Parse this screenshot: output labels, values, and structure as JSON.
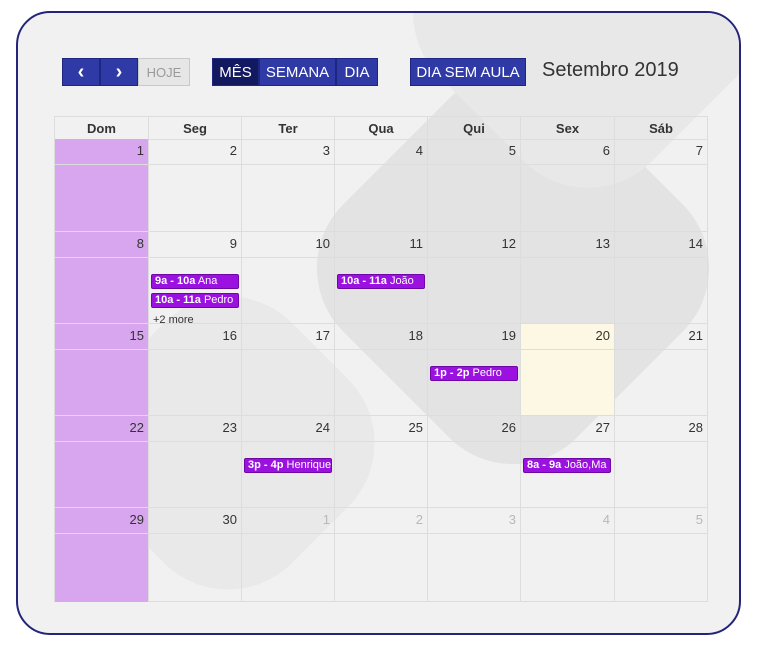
{
  "toolbar": {
    "prev_icon": "‹",
    "next_icon": "›",
    "today_label": "HOJE",
    "month_label": "MÊS",
    "week_label": "SEMANA",
    "day_label": "DIA",
    "no_class_label": "DIA SEM AULA"
  },
  "title": "Setembro 2019",
  "weekdays": [
    "Dom",
    "Seg",
    "Ter",
    "Qua",
    "Qui",
    "Sex",
    "Sáb"
  ],
  "weeks": [
    [
      "1",
      "2",
      "3",
      "4",
      "5",
      "6",
      "7"
    ],
    [
      "8",
      "9",
      "10",
      "11",
      "12",
      "13",
      "14"
    ],
    [
      "15",
      "16",
      "17",
      "18",
      "19",
      "20",
      "21"
    ],
    [
      "22",
      "23",
      "24",
      "25",
      "26",
      "27",
      "28"
    ],
    [
      "29",
      "30",
      "1",
      "2",
      "3",
      "4",
      "5"
    ]
  ],
  "events": [
    {
      "time": "9a - 10a",
      "title": "Ana"
    },
    {
      "time": "10a - 11a",
      "title": "Pedro"
    },
    {
      "time": "10a - 11a",
      "title": "João"
    },
    {
      "time": "1p - 2p",
      "title": "Pedro"
    },
    {
      "time": "3p - 4p",
      "title": "Henrique"
    },
    {
      "time": "8a - 9a",
      "title": "João,Ma"
    }
  ],
  "more_link": "+2 more",
  "colors": {
    "accent": "#2f3aa6",
    "active": "#13195f",
    "event": "#9b11e0",
    "sunday": "#d8a6ee",
    "today": "#fcf8e3",
    "frame": "#23247a"
  }
}
